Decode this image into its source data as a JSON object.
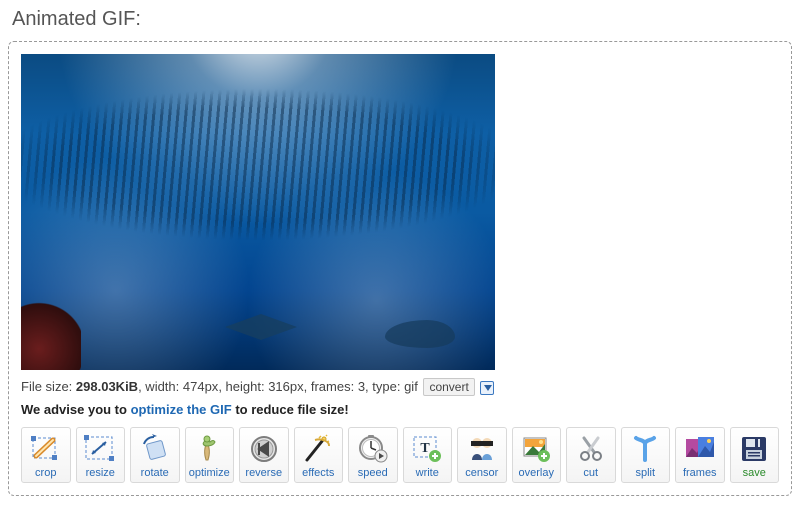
{
  "title": "Animated GIF:",
  "fileinfo": {
    "label_size": "File size:",
    "size": "298.03KiB",
    "sep1": ", width:",
    "width": " 474px",
    "sep2": ", height:",
    "height": " 316px",
    "sep3": ", frames:",
    "frames": " 3",
    "sep4": ", type:",
    "type": " gif",
    "convert_label": "convert"
  },
  "advice": {
    "prefix": "We advise you to ",
    "link": "optimize the GIF",
    "suffix": " to reduce file size!"
  },
  "tools": {
    "crop": "crop",
    "resize": "resize",
    "rotate": "rotate",
    "optimize": "optimize",
    "reverse": "reverse",
    "effects": "effects",
    "speed": "speed",
    "write": "write",
    "censor": "censor",
    "overlay": "overlay",
    "cut": "cut",
    "split": "split",
    "frames": "frames",
    "save": "save"
  }
}
